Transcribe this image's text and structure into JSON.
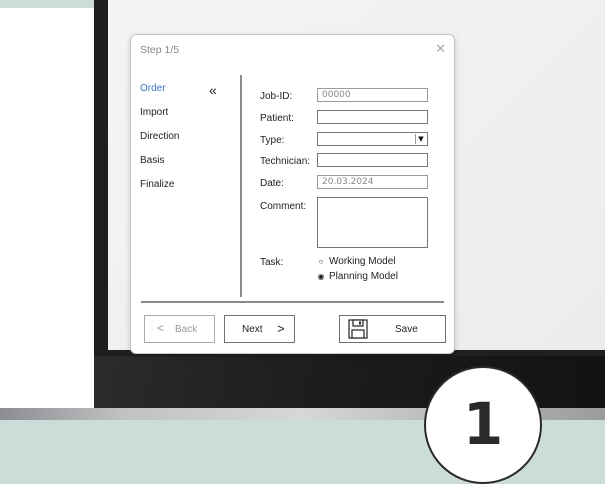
{
  "dialog": {
    "title": "Step 1/5",
    "close": "✕",
    "collapse": "«"
  },
  "nav": {
    "items": [
      {
        "label": "Order"
      },
      {
        "label": "Import"
      },
      {
        "label": "Direction"
      },
      {
        "label": "Basis"
      },
      {
        "label": "Finalize"
      }
    ]
  },
  "form": {
    "job_id_label": "Job-ID:",
    "job_id_value": "00000",
    "patient_label": "Patient:",
    "patient_value": "",
    "type_label": "Type:",
    "type_value": "",
    "technician_label": "Technician:",
    "technician_value": "",
    "date_label": "Date:",
    "date_value": "20.03.2024",
    "comment_label": "Comment:",
    "comment_value": "",
    "task_label": "Task:",
    "task_options": [
      {
        "label": "Working Model",
        "selected": false
      },
      {
        "label": "Planning Model",
        "selected": true
      }
    ]
  },
  "buttons": {
    "back": "Back",
    "next": "Next",
    "save": "Save"
  },
  "badge": {
    "number": "1"
  }
}
